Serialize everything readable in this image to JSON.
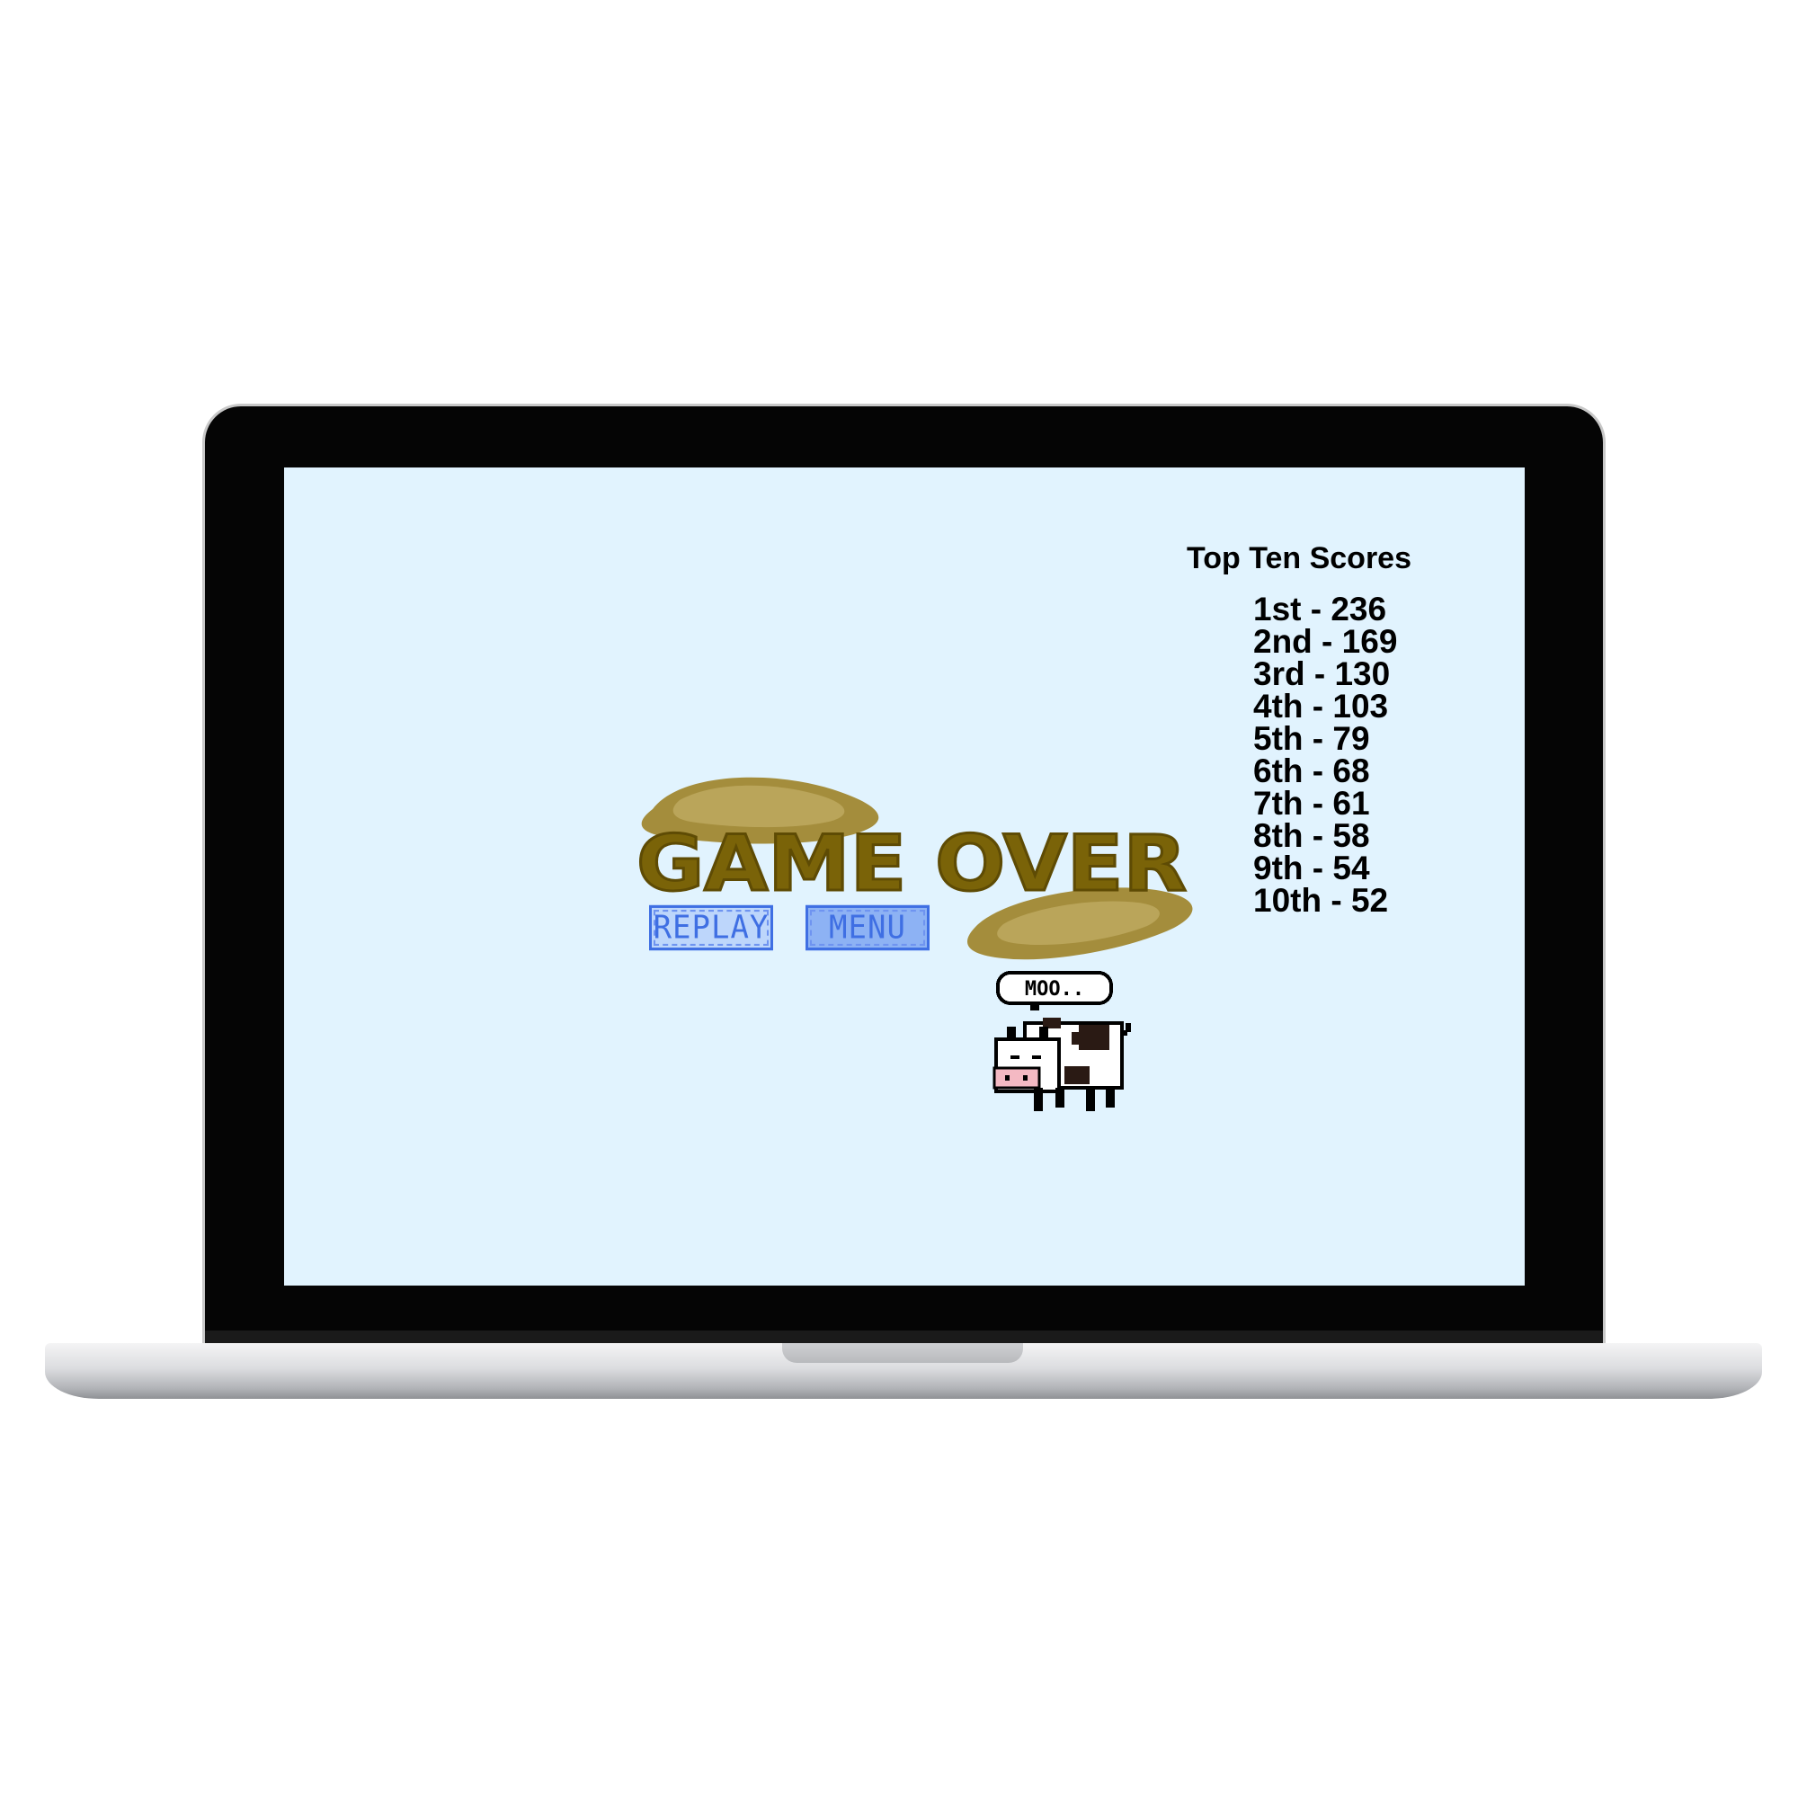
{
  "game": {
    "title_text": "GAME OVER",
    "buttons": {
      "replay_label": "REPLAY",
      "menu_label": "MENU"
    },
    "cow": {
      "speech": "MOO.."
    }
  },
  "scoreboard": {
    "title": "Top Ten Scores",
    "entries": [
      "1st - 236",
      "2nd - 169",
      "3rd - 130",
      "4th - 103",
      "5th - 79",
      "6th - 68",
      "7th - 61",
      "8th - 58",
      "9th - 54",
      "10th - 52"
    ]
  },
  "colors": {
    "screen_background": "#e1f3fe",
    "title_fill": "#7a6308",
    "button_border": "#3f6fe3",
    "replay_fill": "#bdd6fb",
    "menu_fill": "#8db2f4"
  }
}
